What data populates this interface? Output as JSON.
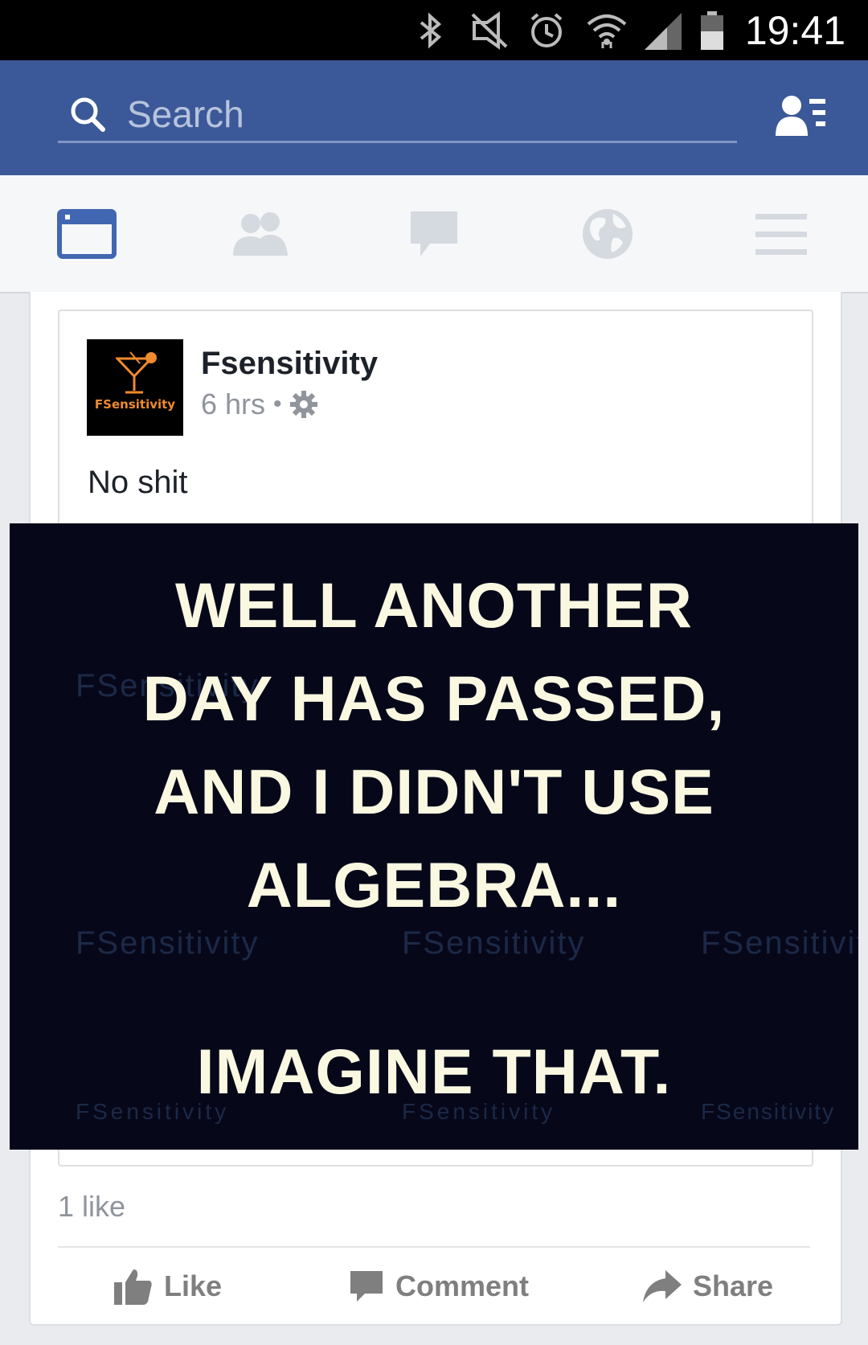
{
  "status_bar": {
    "time": "19:41",
    "icons": [
      "bluetooth-icon",
      "vibrate-icon",
      "alarm-icon",
      "wifi-icon",
      "signal-icon",
      "battery-icon"
    ]
  },
  "search": {
    "placeholder": "Search"
  },
  "tabs": [
    {
      "name": "news-feed",
      "icon": "news-feed-icon",
      "active": true
    },
    {
      "name": "friend-requests",
      "icon": "friends-icon",
      "active": false
    },
    {
      "name": "messages",
      "icon": "chat-icon",
      "active": false
    },
    {
      "name": "notifications",
      "icon": "globe-icon",
      "active": false
    },
    {
      "name": "more",
      "icon": "menu-icon",
      "active": false
    }
  ],
  "post": {
    "author": "Fsensitivity",
    "avatar_label": "FSensitivity",
    "time": "6 hrs",
    "dot": "•",
    "text": "No shit",
    "image": {
      "lines": [
        "WELL ANOTHER",
        "DAY HAS PASSED,",
        "AND I DIDN'T USE",
        "ALGEBRA...",
        "IMAGINE THAT."
      ],
      "watermark": "FSensitivity"
    },
    "likes": "1 like",
    "actions": {
      "like": "Like",
      "comment": "Comment",
      "share": "Share"
    }
  },
  "colors": {
    "brand": "#3b5998",
    "accent_orange": "#f08a2c",
    "image_bg": "#06081a",
    "image_text": "#fbf8e2"
  }
}
